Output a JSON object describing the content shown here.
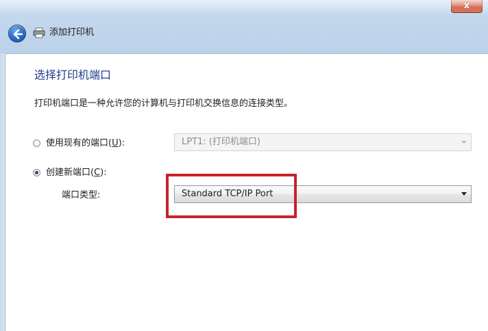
{
  "window": {
    "close_glyph": "x",
    "back_icon": "back-arrow-icon",
    "printer_icon": "printer-icon",
    "title": "添加打印机"
  },
  "page": {
    "heading": "选择打印机端口",
    "description": "打印机端口是一种允许您的计算机与打印机交换信息的连接类型。"
  },
  "options": {
    "existing": {
      "label_prefix": "使用现有的端口(",
      "accesskey": "U",
      "label_suffix": "):",
      "selected": false,
      "select_value": "LPT1: (打印机端口)",
      "enabled": false
    },
    "create_new": {
      "label_prefix": "创建新端口(",
      "accesskey": "C",
      "label_suffix": "):",
      "selected": true
    },
    "port_type": {
      "label": "端口类型:",
      "select_value": "Standard TCP/IP Port"
    }
  },
  "colors": {
    "heading": "#1f3d8c",
    "highlight": "#c8222b"
  }
}
